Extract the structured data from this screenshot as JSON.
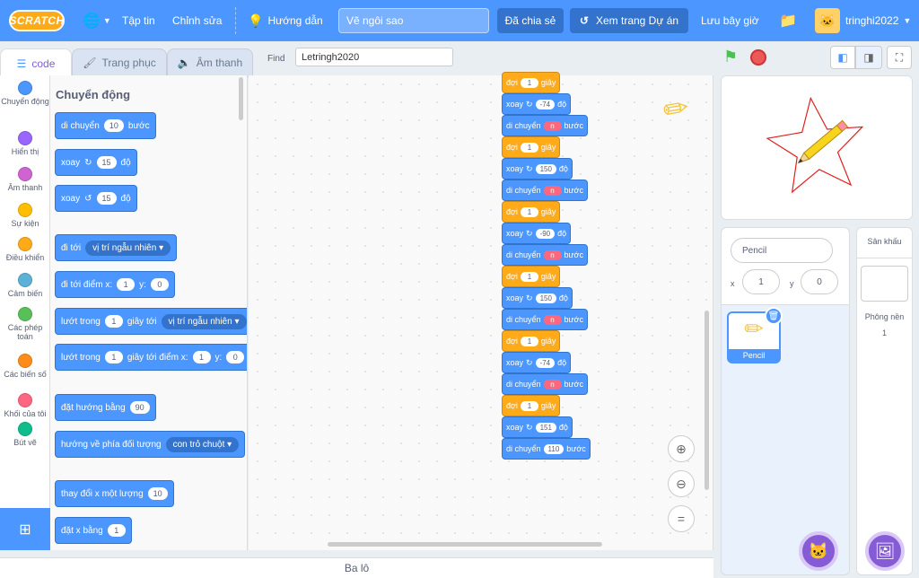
{
  "menubar": {
    "logo": "SCRATCH",
    "file": "Tập tin",
    "edit": "Chỉnh sửa",
    "tutorials": "Hướng dẫn",
    "project_title": "Vẽ ngôi sao",
    "shared": "Đã chia sẻ",
    "see_project": "Xem trang Dự án",
    "save_now": "Lưu bây giờ",
    "username": "tringhi2022"
  },
  "tabs": {
    "code": "code",
    "costumes": "Trang phục",
    "sounds": "Âm thanh"
  },
  "find": {
    "label": "Find",
    "value": "Letringh2020"
  },
  "categories": [
    {
      "label": "Chuyển động",
      "color": "#4c97ff"
    },
    {
      "label": "Hiển thị",
      "color": "#9966ff"
    },
    {
      "label": "Âm thanh",
      "color": "#cf63cf"
    },
    {
      "label": "Sự kiện",
      "color": "#ffbf00"
    },
    {
      "label": "Điều khiển",
      "color": "#ffab19"
    },
    {
      "label": "Cảm biến",
      "color": "#5cb1d6"
    },
    {
      "label": "Các phép toán",
      "color": "#59c059"
    },
    {
      "label": "Các biến số",
      "color": "#ff8c1a"
    },
    {
      "label": "Khối của tôi",
      "color": "#ff6680"
    },
    {
      "label": "Bút vẽ",
      "color": "#0fbd8c"
    }
  ],
  "palette": {
    "heading": "Chuyển động",
    "move": {
      "a": "di chuyển",
      "v": "10",
      "b": "bước"
    },
    "turn_right": {
      "a": "xoay",
      "v": "15",
      "b": "độ"
    },
    "turn_left": {
      "a": "xoay",
      "v": "15",
      "b": "độ"
    },
    "goto": {
      "a": "đi tới",
      "d": "vị trí ngẫu nhiên"
    },
    "goto_xy": {
      "a": "đi tới điểm x:",
      "x": "1",
      "b": "y:",
      "y": "0"
    },
    "glide": {
      "a": "lướt trong",
      "v": "1",
      "b": "giây tới",
      "d": "vị trí ngẫu nhiên"
    },
    "glide_xy": {
      "a": "lướt trong",
      "v": "1",
      "b": "giây tới điểm x:",
      "x": "1",
      "c": "y:",
      "y": "0"
    },
    "point_dir": {
      "a": "đặt hướng bằng",
      "v": "90"
    },
    "point_towards": {
      "a": "hướng về phía đối tượng",
      "d": "con trỏ chuột"
    },
    "change_x": {
      "a": "thay đổi x một lượng",
      "v": "10"
    },
    "set_x": {
      "a": "đặt x bằng",
      "v": "1"
    }
  },
  "script": {
    "wait": "đợi",
    "seconds": "giây",
    "turn": "xoay",
    "degrees": "độ",
    "move": "di chuyển",
    "steps": "bước",
    "var": "n",
    "blocks": [
      {
        "t": "wait",
        "v": "1"
      },
      {
        "t": "turn",
        "v": "-74"
      },
      {
        "t": "move"
      },
      {
        "t": "wait",
        "v": "1"
      },
      {
        "t": "turn",
        "v": "150"
      },
      {
        "t": "move"
      },
      {
        "t": "wait",
        "v": "1"
      },
      {
        "t": "turn",
        "v": "-90"
      },
      {
        "t": "move"
      },
      {
        "t": "wait",
        "v": "1"
      },
      {
        "t": "turn",
        "v": "150"
      },
      {
        "t": "move"
      },
      {
        "t": "wait",
        "v": "1"
      },
      {
        "t": "turn",
        "v": "-74"
      },
      {
        "t": "move"
      },
      {
        "t": "wait",
        "v": "1"
      },
      {
        "t": "turn",
        "v": "151"
      },
      {
        "t": "move",
        "v": "110"
      }
    ]
  },
  "sprite": {
    "name": "Pencil",
    "x": "1",
    "y": "0",
    "x_label": "x",
    "y_label": "y",
    "thumb_label": "Pencil"
  },
  "stage_panel": {
    "title": "Sân khấu",
    "backdrops_label": "Phông nền",
    "backdrops_count": "1"
  },
  "backpack": "Ba lô",
  "colors": {
    "motion": "#4c97ff",
    "control": "#ffab19",
    "accent": "#855cd6",
    "star": "#e02020"
  }
}
